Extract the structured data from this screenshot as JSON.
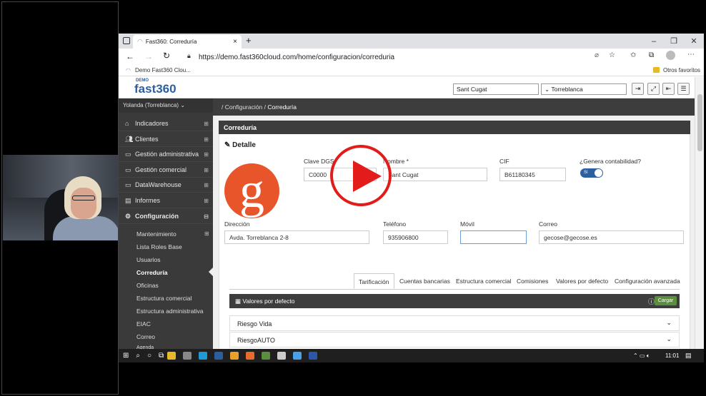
{
  "browser": {
    "tab_title": "Fast360: Correduría",
    "url": "https://demo.fast360cloud.com/home/configuracion/correduria",
    "favorites": [
      "Demo Fast360 Clou...",
      "Otros favoritos"
    ]
  },
  "header": {
    "logo_top": "DEMO",
    "logo_text": "fast360",
    "office_select": "Sant Cugat",
    "branch_select": "Torreblanca"
  },
  "sidebar": {
    "user": "Yolanda (Torreblanca)",
    "items": [
      {
        "label": "Indicadores"
      },
      {
        "label": "Clientes"
      },
      {
        "label": "Gestión administrativa"
      },
      {
        "label": "Gestión comercial"
      },
      {
        "label": "DataWarehouse"
      },
      {
        "label": "Informes"
      },
      {
        "label": "Configuración"
      }
    ],
    "subitems": [
      "Mantenimiento",
      "Lista Roles Base",
      "Usuarios",
      "Correduría",
      "Oficinas",
      "Estructura comercial",
      "Estructura administrativa",
      "EIAC",
      "Correo",
      "Agenda"
    ]
  },
  "breadcrumb": {
    "sep": "/",
    "parent": "Configuración",
    "current": "Correduría"
  },
  "card": {
    "title": "Correduría",
    "section": "Detalle",
    "logo_letter": "g",
    "fields": {
      "clave_label": "Clave DGS",
      "clave_value": "C0000",
      "nombre_label": "Nombre *",
      "nombre_value": "Sant Cugat",
      "cif_label": "CIF",
      "cif_value": "B61180345",
      "contab_label": "¿Genera contabilidad?",
      "contab_value": "Sí",
      "direccion_label": "Dirección",
      "direccion_value": "Avda. Torreblanca 2-8",
      "telefono_label": "Teléfono",
      "telefono_value": "935906800",
      "movil_label": "Móvil",
      "movil_value": "",
      "correo_label": "Correo",
      "correo_value": "gecose@gecose.es"
    },
    "tabs": [
      "Tarificación",
      "Cuentas bancarias",
      "Estructura comercial",
      "Comisiones",
      "Valores por defecto",
      "Configuración avanzada"
    ],
    "panel_title": "Valores por defecto",
    "panel_button": "Cargar",
    "accordion": [
      "Riesgo Vida",
      "RiesgoAUTO"
    ]
  },
  "taskbar": {
    "time": "11:01"
  },
  "colors": {
    "accent": "#e8552b",
    "dark": "#3d3d3d",
    "play": "#e31b1b"
  }
}
